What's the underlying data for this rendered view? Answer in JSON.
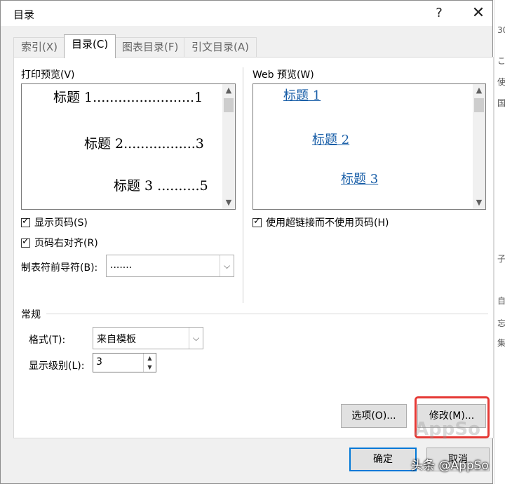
{
  "window": {
    "title": "目录",
    "help": "?",
    "close": "✕"
  },
  "tabs": [
    {
      "label": "索引(X)",
      "active": false
    },
    {
      "label": "目录(C)",
      "active": true
    },
    {
      "label": "图表目录(F)",
      "active": false
    },
    {
      "label": "引文目录(A)",
      "active": false
    }
  ],
  "print_preview": {
    "label": "打印预览(V)",
    "lines": [
      "标题 1........................1",
      "标题 2.................3",
      "标题 3 ..........5"
    ]
  },
  "web_preview": {
    "label": "Web 预览(W)",
    "lines": [
      "标题 1",
      "标题 2",
      "标题 3"
    ]
  },
  "options": {
    "show_page_numbers": "显示页码(S)",
    "right_align": "页码右对齐(R)",
    "tab_leader_label": "制表符前导符(B):",
    "tab_leader_value": ".......",
    "use_hyperlinks": "使用超链接而不使用页码(H)"
  },
  "general": {
    "title": "常规",
    "format_label": "格式(T):",
    "format_value": "来自模板",
    "levels_label": "显示级别(L):",
    "levels_value": "3"
  },
  "buttons": {
    "options": "选项(O)...",
    "modify": "修改(M)...",
    "ok": "确定",
    "cancel": "取消"
  },
  "overlay": {
    "watermark": "AppSo",
    "caption": "头条 @AppSo"
  },
  "background_fragments": [
    "30",
    "こ",
    "使",
    "国",
    "子",
    "自",
    "忘",
    "集"
  ]
}
